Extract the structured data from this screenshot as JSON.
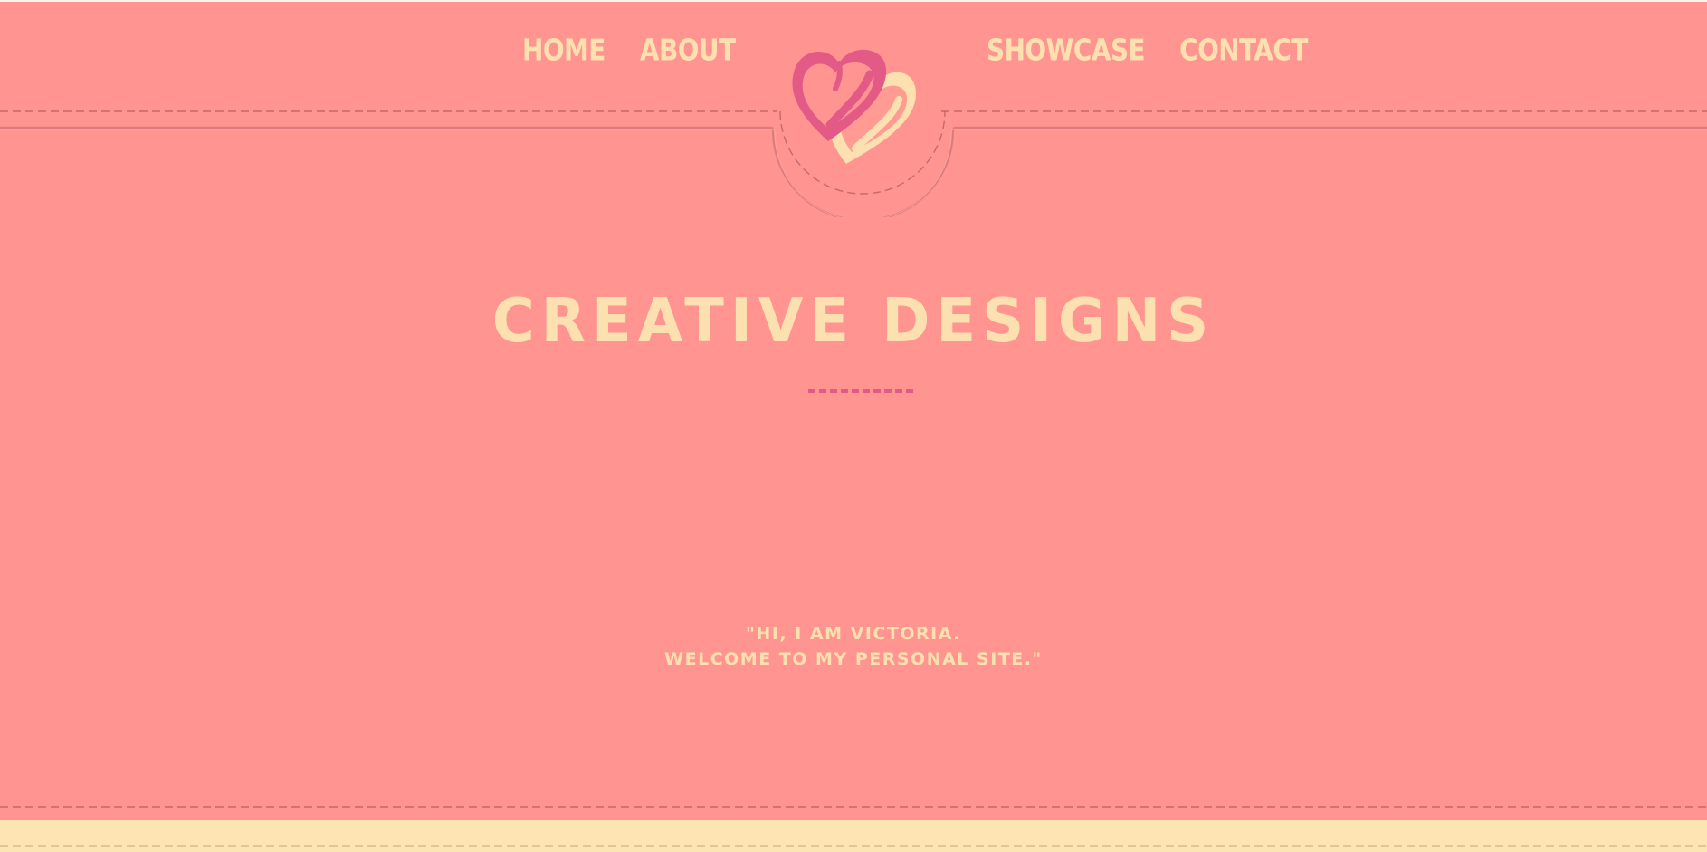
{
  "nav": {
    "left": [
      {
        "label": "HOME"
      },
      {
        "label": "ABOUT"
      }
    ],
    "right": [
      {
        "label": "SHOWCASE"
      },
      {
        "label": "CONTACT"
      }
    ]
  },
  "logo": {
    "icon": "double-heart-icon"
  },
  "hero": {
    "title": "CREATIVE DESIGNS",
    "quote_line1": "\"HI, I AM VICTORIA.",
    "quote_line2": "WELCOME TO MY PERSONAL SITE.\""
  },
  "colors": {
    "background": "#ff9490",
    "text": "#fde0b0",
    "accent": "#e35a86",
    "footer": "#fde4b3",
    "stitch": "#b25a5a"
  }
}
